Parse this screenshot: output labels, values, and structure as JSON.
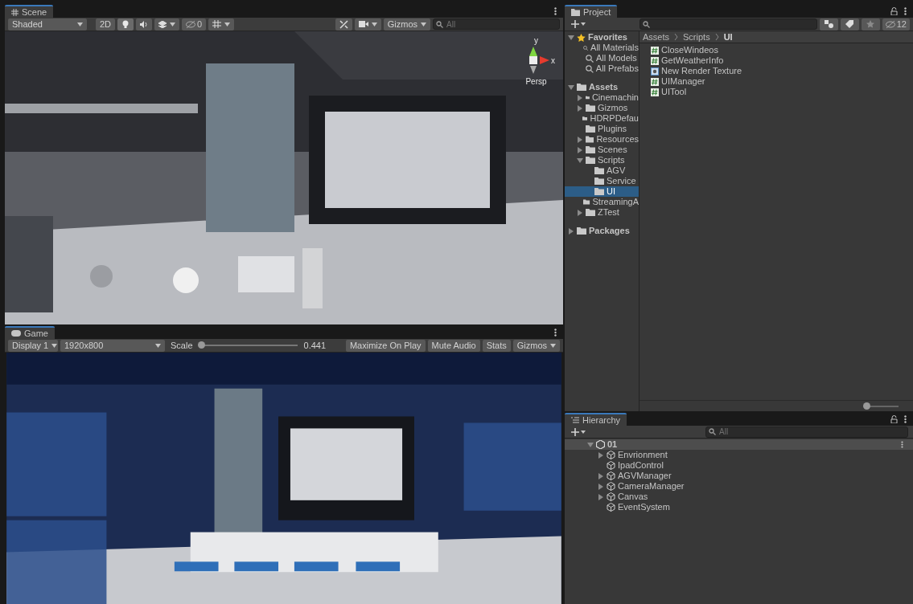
{
  "scene": {
    "tab": "Scene",
    "toolbar": {
      "shading": "Shaded",
      "mode_2d": "2D",
      "lighting_on": true,
      "hidden_count": "0",
      "gizmos": "Gizmos",
      "search_placeholder": "All"
    },
    "view": {
      "projection": "Persp",
      "axis_y": "y",
      "axis_x": "x"
    }
  },
  "game": {
    "tab": "Game",
    "toolbar": {
      "display": "Display 1",
      "resolution": "1920x800",
      "scale_label": "Scale",
      "scale": {
        "level": 0.02
      },
      "scale_reading": "0.441",
      "buttons": [
        "Maximize On Play",
        "Mute Audio",
        "Stats"
      ],
      "gizmos": "Gizmos"
    }
  },
  "project": {
    "tab": "Project",
    "hidden_count": "12",
    "tree": [
      {
        "label": "Favorites",
        "kind": "favorites",
        "expanded": true,
        "selected": false,
        "children": [
          {
            "label": "All Materials",
            "kind": "search",
            "selected": false
          },
          {
            "label": "All Models",
            "kind": "search",
            "selected": false
          },
          {
            "label": "All Prefabs",
            "kind": "search",
            "selected": false
          }
        ]
      },
      {
        "label": "Assets",
        "kind": "root",
        "expanded": true,
        "selected": false,
        "children": [
          {
            "label": "Cinemachin",
            "kind": "folder",
            "expanded": false,
            "selected": false
          },
          {
            "label": "Gizmos",
            "kind": "folder",
            "expanded": false,
            "selected": false
          },
          {
            "label": "HDRPDefau",
            "kind": "folder",
            "selected": false
          },
          {
            "label": "Plugins",
            "kind": "folder",
            "selected": false
          },
          {
            "label": "Resources",
            "kind": "folder",
            "expanded": false,
            "selected": false
          },
          {
            "label": "Scenes",
            "kind": "folder",
            "expanded": false,
            "selected": false
          },
          {
            "label": "Scripts",
            "kind": "folder",
            "expanded": true,
            "selected": false,
            "children": [
              {
                "label": "AGV",
                "kind": "folder",
                "selected": false
              },
              {
                "label": "Service",
                "kind": "folder",
                "selected": false
              },
              {
                "label": "UI",
                "kind": "folder",
                "selected": true
              }
            ]
          },
          {
            "label": "StreamingA",
            "kind": "folder",
            "selected": false
          },
          {
            "label": "ZTest",
            "kind": "folder",
            "expanded": false,
            "selected": false
          }
        ]
      },
      {
        "label": "Packages",
        "kind": "root",
        "expanded": false,
        "selected": false
      }
    ],
    "breadcrumb": [
      "Assets",
      "Scripts",
      "UI"
    ],
    "files": [
      {
        "name": "CloseWindeos",
        "kind": "script"
      },
      {
        "name": "GetWeatherInfo",
        "kind": "script"
      },
      {
        "name": "New Render Texture",
        "kind": "texture"
      },
      {
        "name": "UIManager",
        "kind": "script"
      },
      {
        "name": "UITool",
        "kind": "script"
      }
    ],
    "icon_size": {
      "level": 0.0
    }
  },
  "hierarchy": {
    "tab": "Hierarchy",
    "search_placeholder": "All",
    "items": [
      {
        "label": "01",
        "kind": "scene",
        "expanded": true,
        "children": [
          {
            "label": "Envrionment",
            "kind": "object",
            "expanded": false
          },
          {
            "label": "IpadControl",
            "kind": "object"
          },
          {
            "label": "AGVManager",
            "kind": "object",
            "expanded": false
          },
          {
            "label": "CameraManager",
            "kind": "object",
            "expanded": false
          },
          {
            "label": "Canvas",
            "kind": "object",
            "expanded": false
          },
          {
            "label": "EventSystem",
            "kind": "object"
          }
        ]
      }
    ]
  }
}
